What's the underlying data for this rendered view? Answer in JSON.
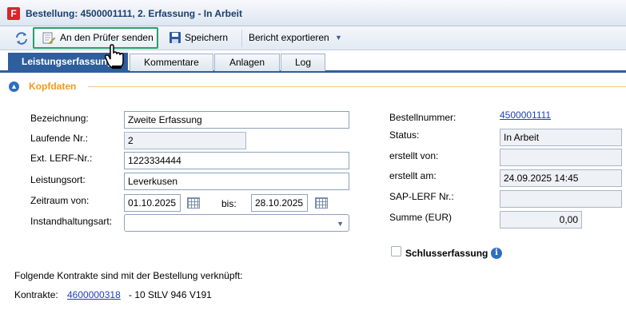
{
  "window": {
    "logo_letter": "F",
    "title": "Bestellung: 4500001111, 2. Erfassung - In Arbeit"
  },
  "toolbar": {
    "refresh_icon": "refresh-icon",
    "send_label": "An den Prüfer senden",
    "save_label": "Speichern",
    "export_label": "Bericht exportieren"
  },
  "tabs": [
    {
      "label": "Leistungserfassung",
      "active": true
    },
    {
      "label": "Kommentare",
      "active": false
    },
    {
      "label": "Anlagen",
      "active": false
    },
    {
      "label": "Log",
      "active": false
    }
  ],
  "section": {
    "title": "Kopfdaten"
  },
  "form_left": {
    "bezeichnung": {
      "label": "Bezeichnung:",
      "value": "Zweite Erfassung"
    },
    "laufende_nr": {
      "label": "Laufende Nr.:",
      "value": "2"
    },
    "ext_lerf": {
      "label": "Ext. LERF-Nr.:",
      "value": "1223334444"
    },
    "leistungsort": {
      "label": "Leistungsort:",
      "value": "Leverkusen"
    },
    "zeitraum": {
      "label": "Zeitraum von:",
      "from": "01.10.2025",
      "bis_label": "bis:",
      "to": "28.10.2025"
    },
    "instandhaltungsart": {
      "label": "Instandhaltungsart:",
      "value": ""
    }
  },
  "form_right": {
    "bestellnummer": {
      "label": "Bestellnummer:",
      "value": "4500001111"
    },
    "status": {
      "label": "Status:",
      "value": "In Arbeit"
    },
    "erstellt_von": {
      "label": "erstellt von:",
      "value": ""
    },
    "erstellt_am": {
      "label": "erstellt am:",
      "value": "24.09.2025 14:45"
    },
    "sap_lerf": {
      "label": "SAP-LERF Nr.:",
      "value": ""
    },
    "summe": {
      "label": "Summe (EUR)",
      "value": "0,00"
    }
  },
  "schlusserfassung": {
    "label": "Schlusserfassung",
    "checked": false
  },
  "contracts": {
    "intro": "Folgende Kontrakte sind mit der Bestellung verknüpft:",
    "label": "Kontrakte:",
    "link": "4600000318",
    "suffix": "- 10 StLV 946 V191"
  },
  "colors": {
    "accent": "#2f5e9c",
    "section": "#f29a1b",
    "highlight": "#27a06c"
  }
}
